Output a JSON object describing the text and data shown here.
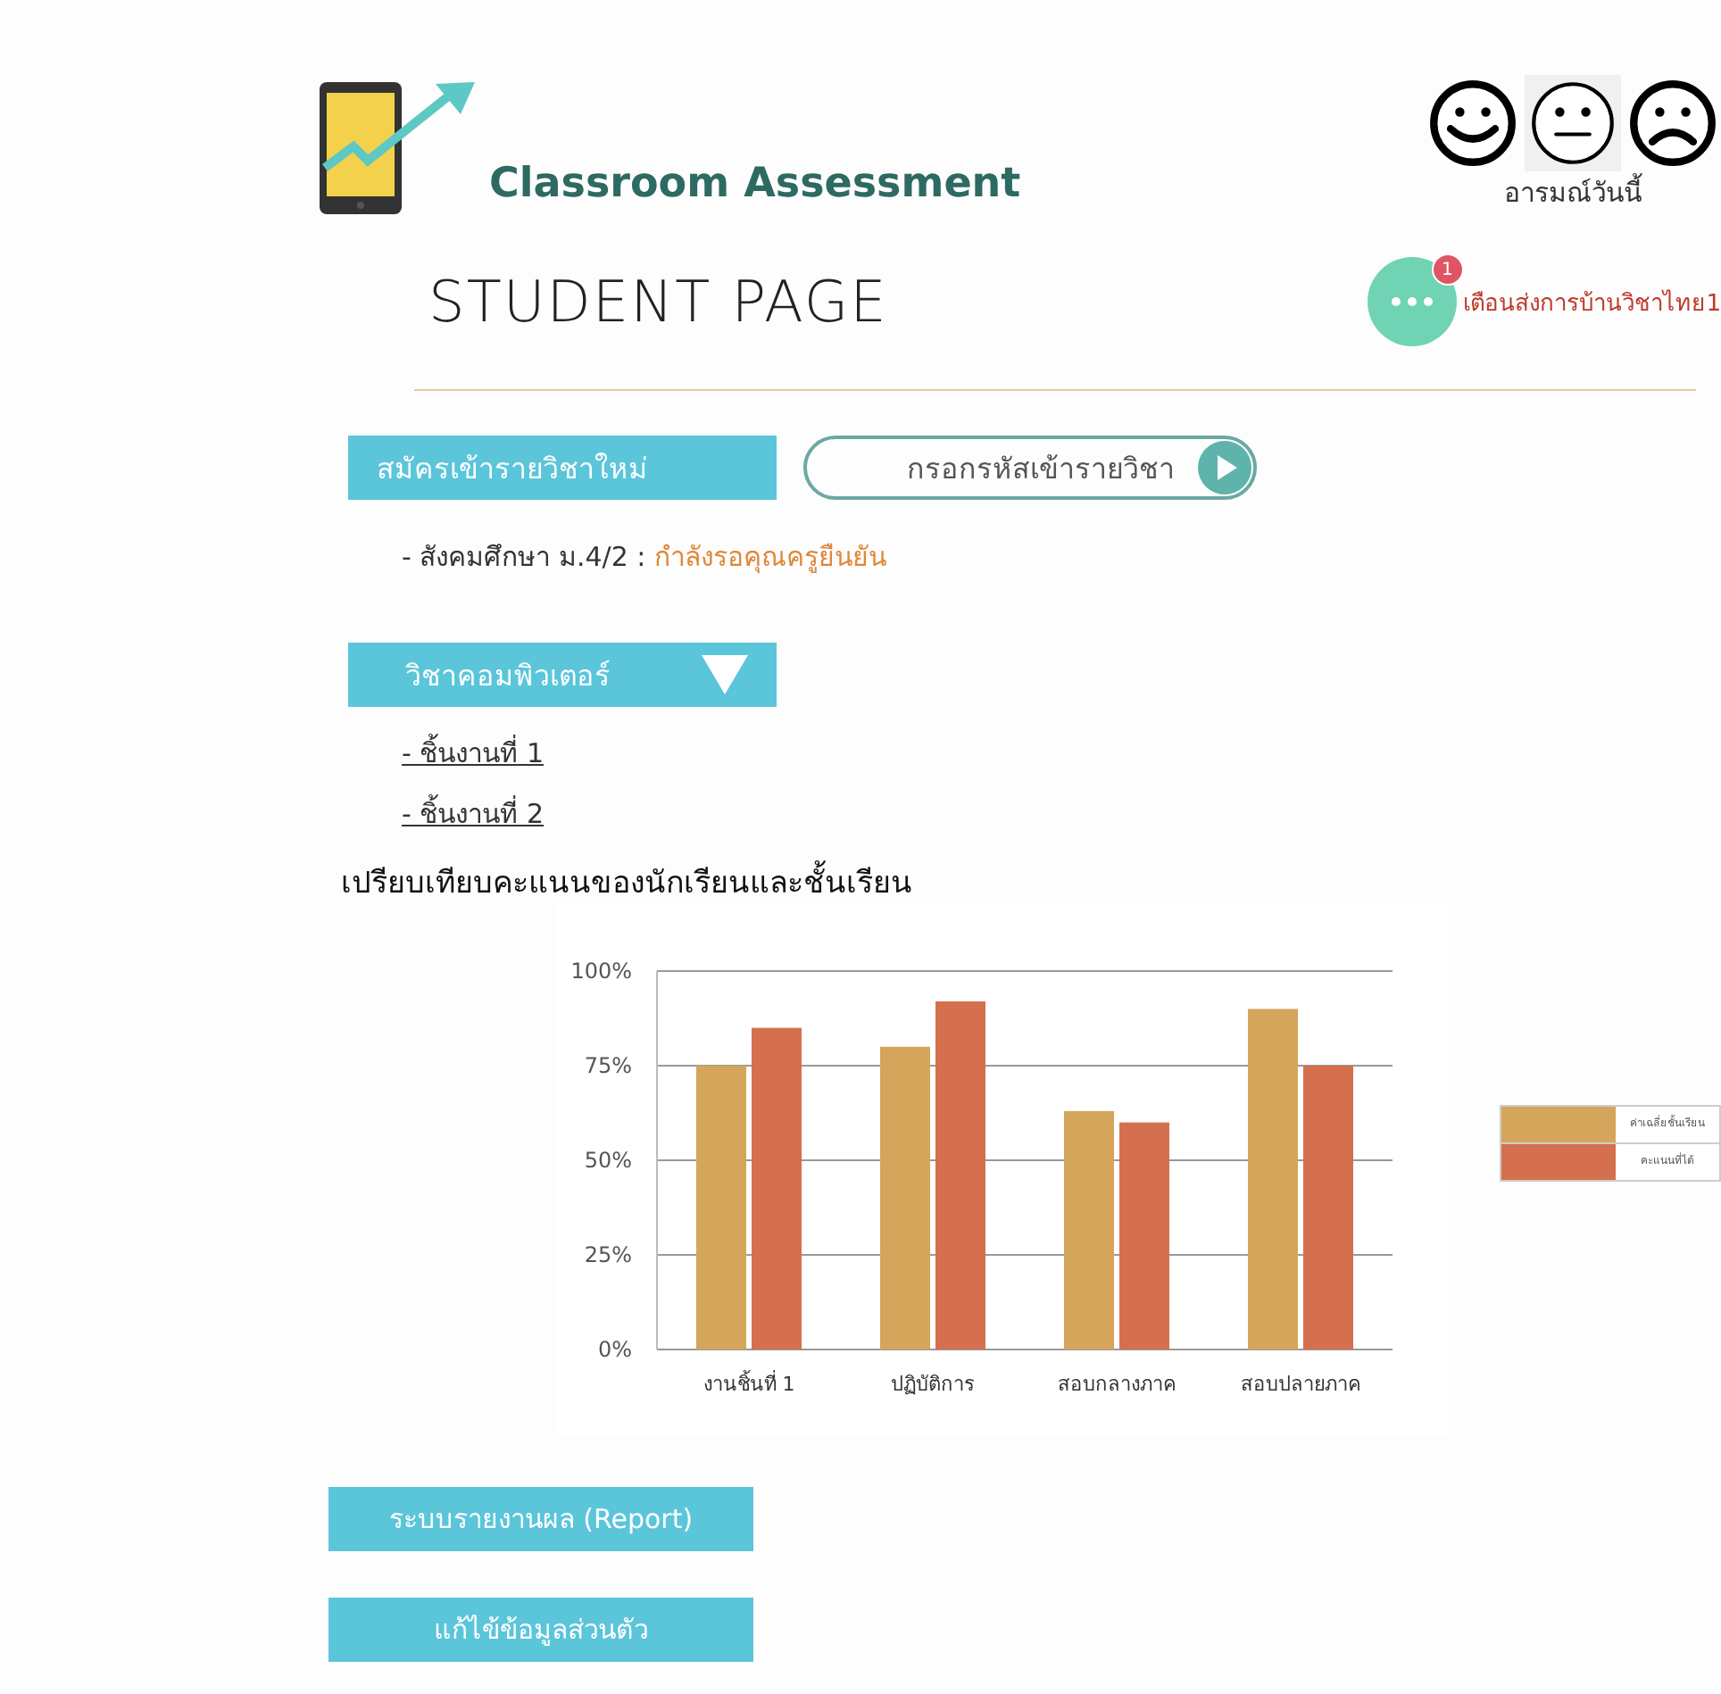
{
  "header": {
    "title": "Classroom Assessment",
    "moods": [
      {
        "kind": "happy",
        "selected": false
      },
      {
        "kind": "neutral",
        "selected": true
      },
      {
        "kind": "sad",
        "selected": false
      }
    ],
    "mood_label": "อารมณ์วันนี้"
  },
  "page_title": "STUDENT PAGE",
  "notification": {
    "badge": "1",
    "text": "เตือนส่งการบ้านวิชาไทย1"
  },
  "enroll_button": "สมัครเข้ารายวิชาใหม่",
  "code_field": {
    "placeholder": "กรอกรหัสเข้ารายวิชา"
  },
  "pending": {
    "subject": "- สังคมศึกษา ม.4/2 :",
    "status": "กำลังรอคุณครูยืนยัน"
  },
  "course": {
    "title": "วิชาคอมพิวเตอร์",
    "expanded": true,
    "items": [
      "- ชิ้นงานที่ 1",
      "- ชิ้นงานที่ 2"
    ]
  },
  "chart": {
    "heading": "เปรียบเทียบคะแนนของนักเรียนและชั้นเรียน",
    "chart_data": {
      "type": "bar",
      "categories": [
        "งานชิ้นที่ 1",
        "ปฏิบัติการ",
        "สอบกลางภาค",
        "สอบปลายภาค"
      ],
      "series": [
        {
          "name": "ค่าเฉลี่ยชั้นเรียน",
          "color": "#d4a55a",
          "values": [
            75,
            80,
            63,
            90
          ]
        },
        {
          "name": "คะแนนที่ได้",
          "color": "#d4704e",
          "values": [
            85,
            92,
            60,
            75
          ]
        }
      ],
      "grid": true,
      "ylim": [
        0,
        100
      ],
      "yticks": [
        {
          "value": 0,
          "label": "0%"
        },
        {
          "value": 25,
          "label": "25%"
        },
        {
          "value": 50,
          "label": "50%"
        },
        {
          "value": 75,
          "label": "75%"
        },
        {
          "value": 100,
          "label": "100%"
        }
      ]
    }
  },
  "menu_buttons": [
    "ระบบรายงานผล (Report)",
    "แก้ไข้ข้อมูลส่วนตัว"
  ]
}
